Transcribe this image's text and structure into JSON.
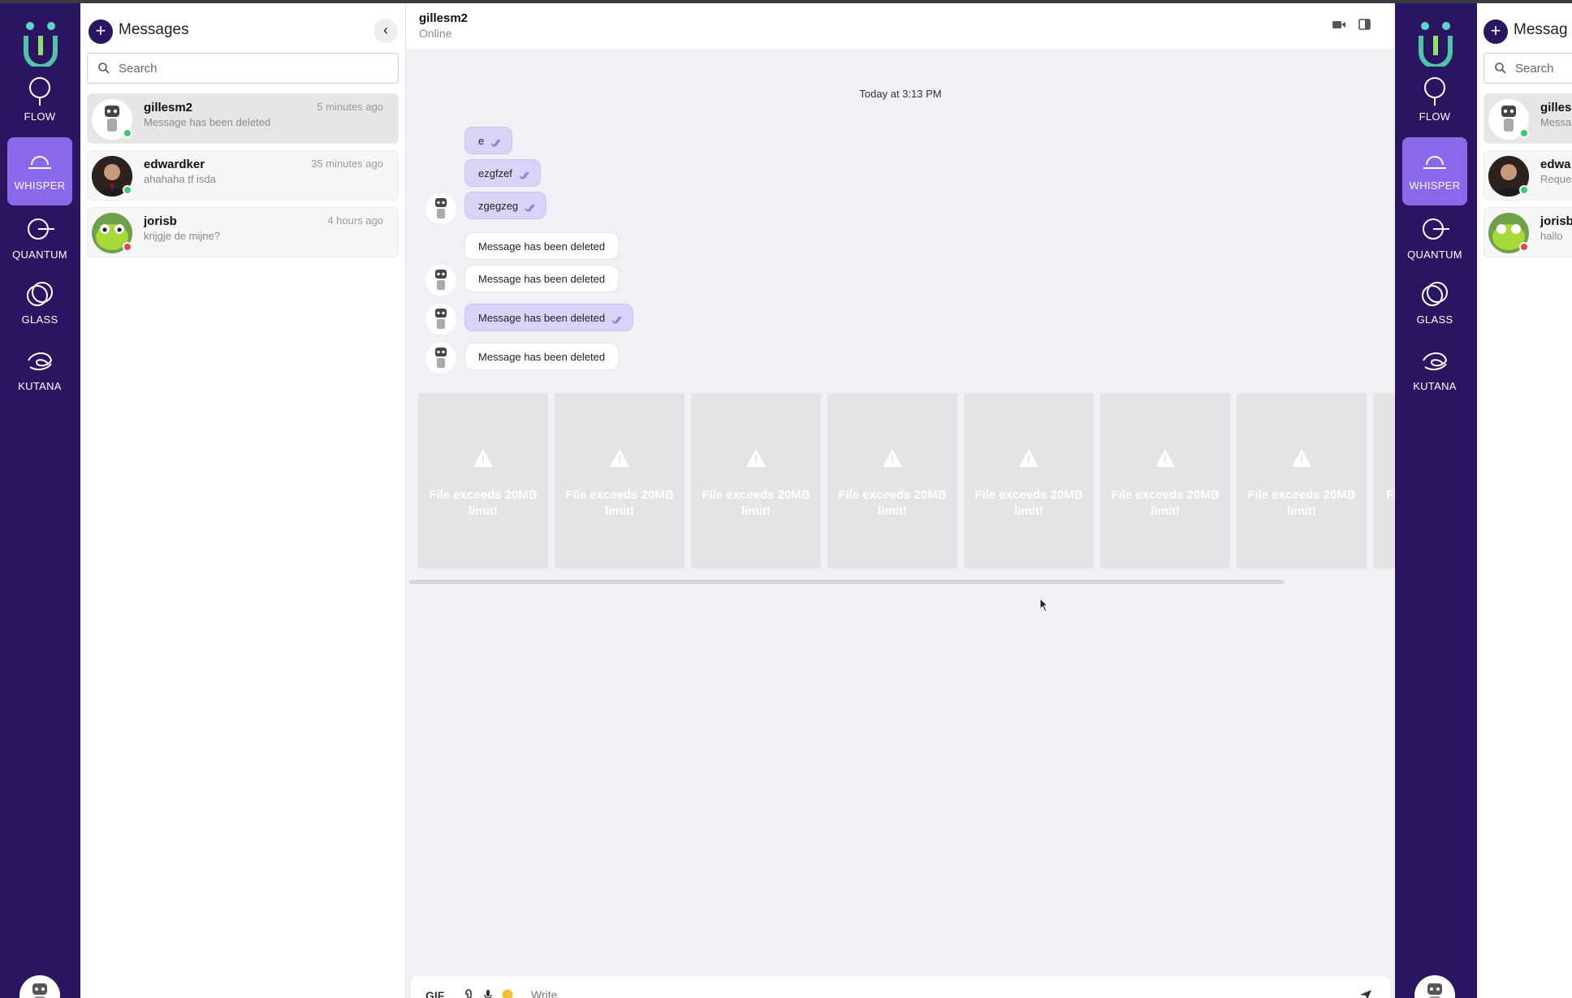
{
  "nav": {
    "items": [
      {
        "label": "FLOW",
        "icon": "flow-icon"
      },
      {
        "label": "WHISPER",
        "icon": "whisper-icon",
        "active": true
      },
      {
        "label": "QUANTUM",
        "icon": "quantum-icon"
      },
      {
        "label": "GLASS",
        "icon": "glass-icon"
      },
      {
        "label": "KUTANA",
        "icon": "kutana-icon"
      }
    ]
  },
  "messages_panel": {
    "title": "Messages",
    "search_placeholder": "Search",
    "conversations": [
      {
        "name": "gillesm2",
        "preview": "Message has been deleted",
        "time": "5 minutes ago",
        "status": "online"
      },
      {
        "name": "edwardker",
        "preview": "ahahaha tf isda",
        "time": "35 minutes ago",
        "status": "online"
      },
      {
        "name": "jorisb",
        "preview": "krijgje de mijne?",
        "time": "4 hours ago",
        "status": "busy"
      }
    ]
  },
  "chat": {
    "contact_name": "gillesm2",
    "contact_status": "Online",
    "date_separator": "Today at 3:13 PM",
    "messages": [
      {
        "text": "e",
        "mine": true
      },
      {
        "text": "ezgfzef",
        "mine": true
      },
      {
        "text": "zgegzeg",
        "mine": true
      },
      {
        "text": "Message has been deleted",
        "mine": false
      },
      {
        "text": "Message has been deleted",
        "mine": false
      },
      {
        "text": "Message has been deleted",
        "mine": true
      },
      {
        "text": "Message has been deleted",
        "mine": false
      }
    ],
    "file_error": "File exceeds 20MB limit!",
    "file_error_partial": "Fi",
    "composer": {
      "gif_label": "GIF",
      "placeholder": "Write"
    }
  },
  "right_panel": {
    "title": "Messag",
    "search_placeholder": "Search",
    "conversations": [
      {
        "name": "gilles",
        "preview": "Messa",
        "status": "online"
      },
      {
        "name": "edwa",
        "preview": "Reques",
        "status": "online"
      },
      {
        "name": "jorisb",
        "preview": "hallo",
        "status": "busy"
      }
    ]
  },
  "colors": {
    "rail": "#2b1461",
    "accent": "#8b67ea",
    "online": "#3ec96b",
    "busy": "#e8434a",
    "bubble_mine": "#d9d3f7"
  }
}
